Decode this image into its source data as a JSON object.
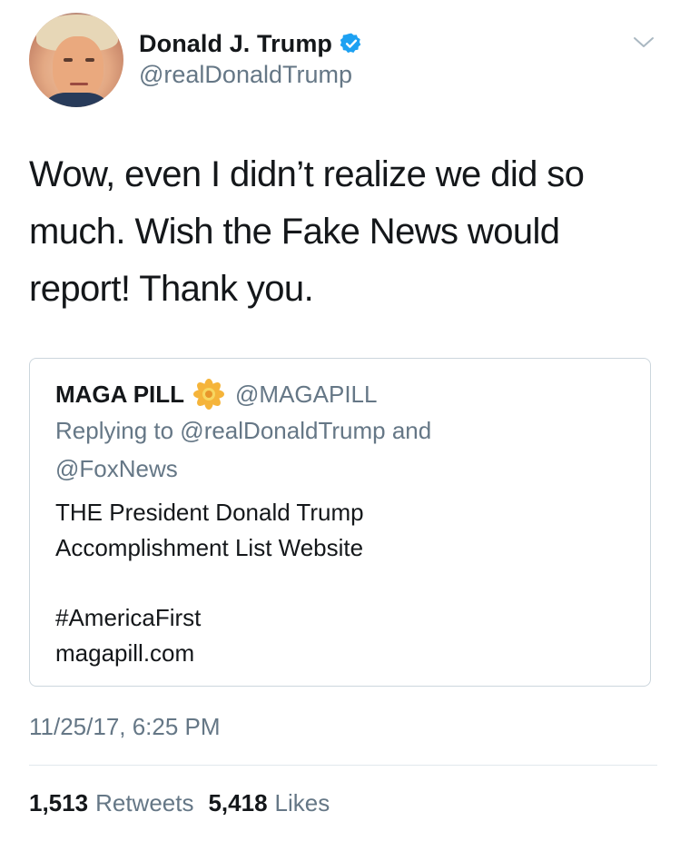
{
  "author": {
    "display_name": "Donald J. Trump",
    "handle": "@realDonaldTrump",
    "verified": true
  },
  "tweet": {
    "text_lines": [
      "Wow, even I didn’t realize we did so",
      "much. Wish the Fake News would",
      "report! Thank you."
    ],
    "timestamp": "11/25/17, 6:25 PM"
  },
  "quoted_tweet": {
    "name": "MAGA PILL",
    "handle": "@MAGAPILL",
    "replying_lines": [
      "Replying to @realDonaldTrump and",
      "@FoxNews"
    ],
    "body_lines": [
      "THE President Donald Trump",
      "Accomplishment List Website"
    ],
    "hashtag": "#AmericaFirst",
    "link": "magapill.com"
  },
  "stats": {
    "retweets_count": "1,513",
    "retweets_label": "Retweets",
    "likes_count": "5,418",
    "likes_label": "Likes"
  },
  "icons": {
    "verified": "verified-badge-icon",
    "menu": "chevron-down-icon",
    "flower": "flower-emoji-icon"
  },
  "colors": {
    "primary_text": "#14171a",
    "secondary_text": "#657786",
    "verified_blue": "#1da1f2",
    "border": "#ccd6dd"
  }
}
